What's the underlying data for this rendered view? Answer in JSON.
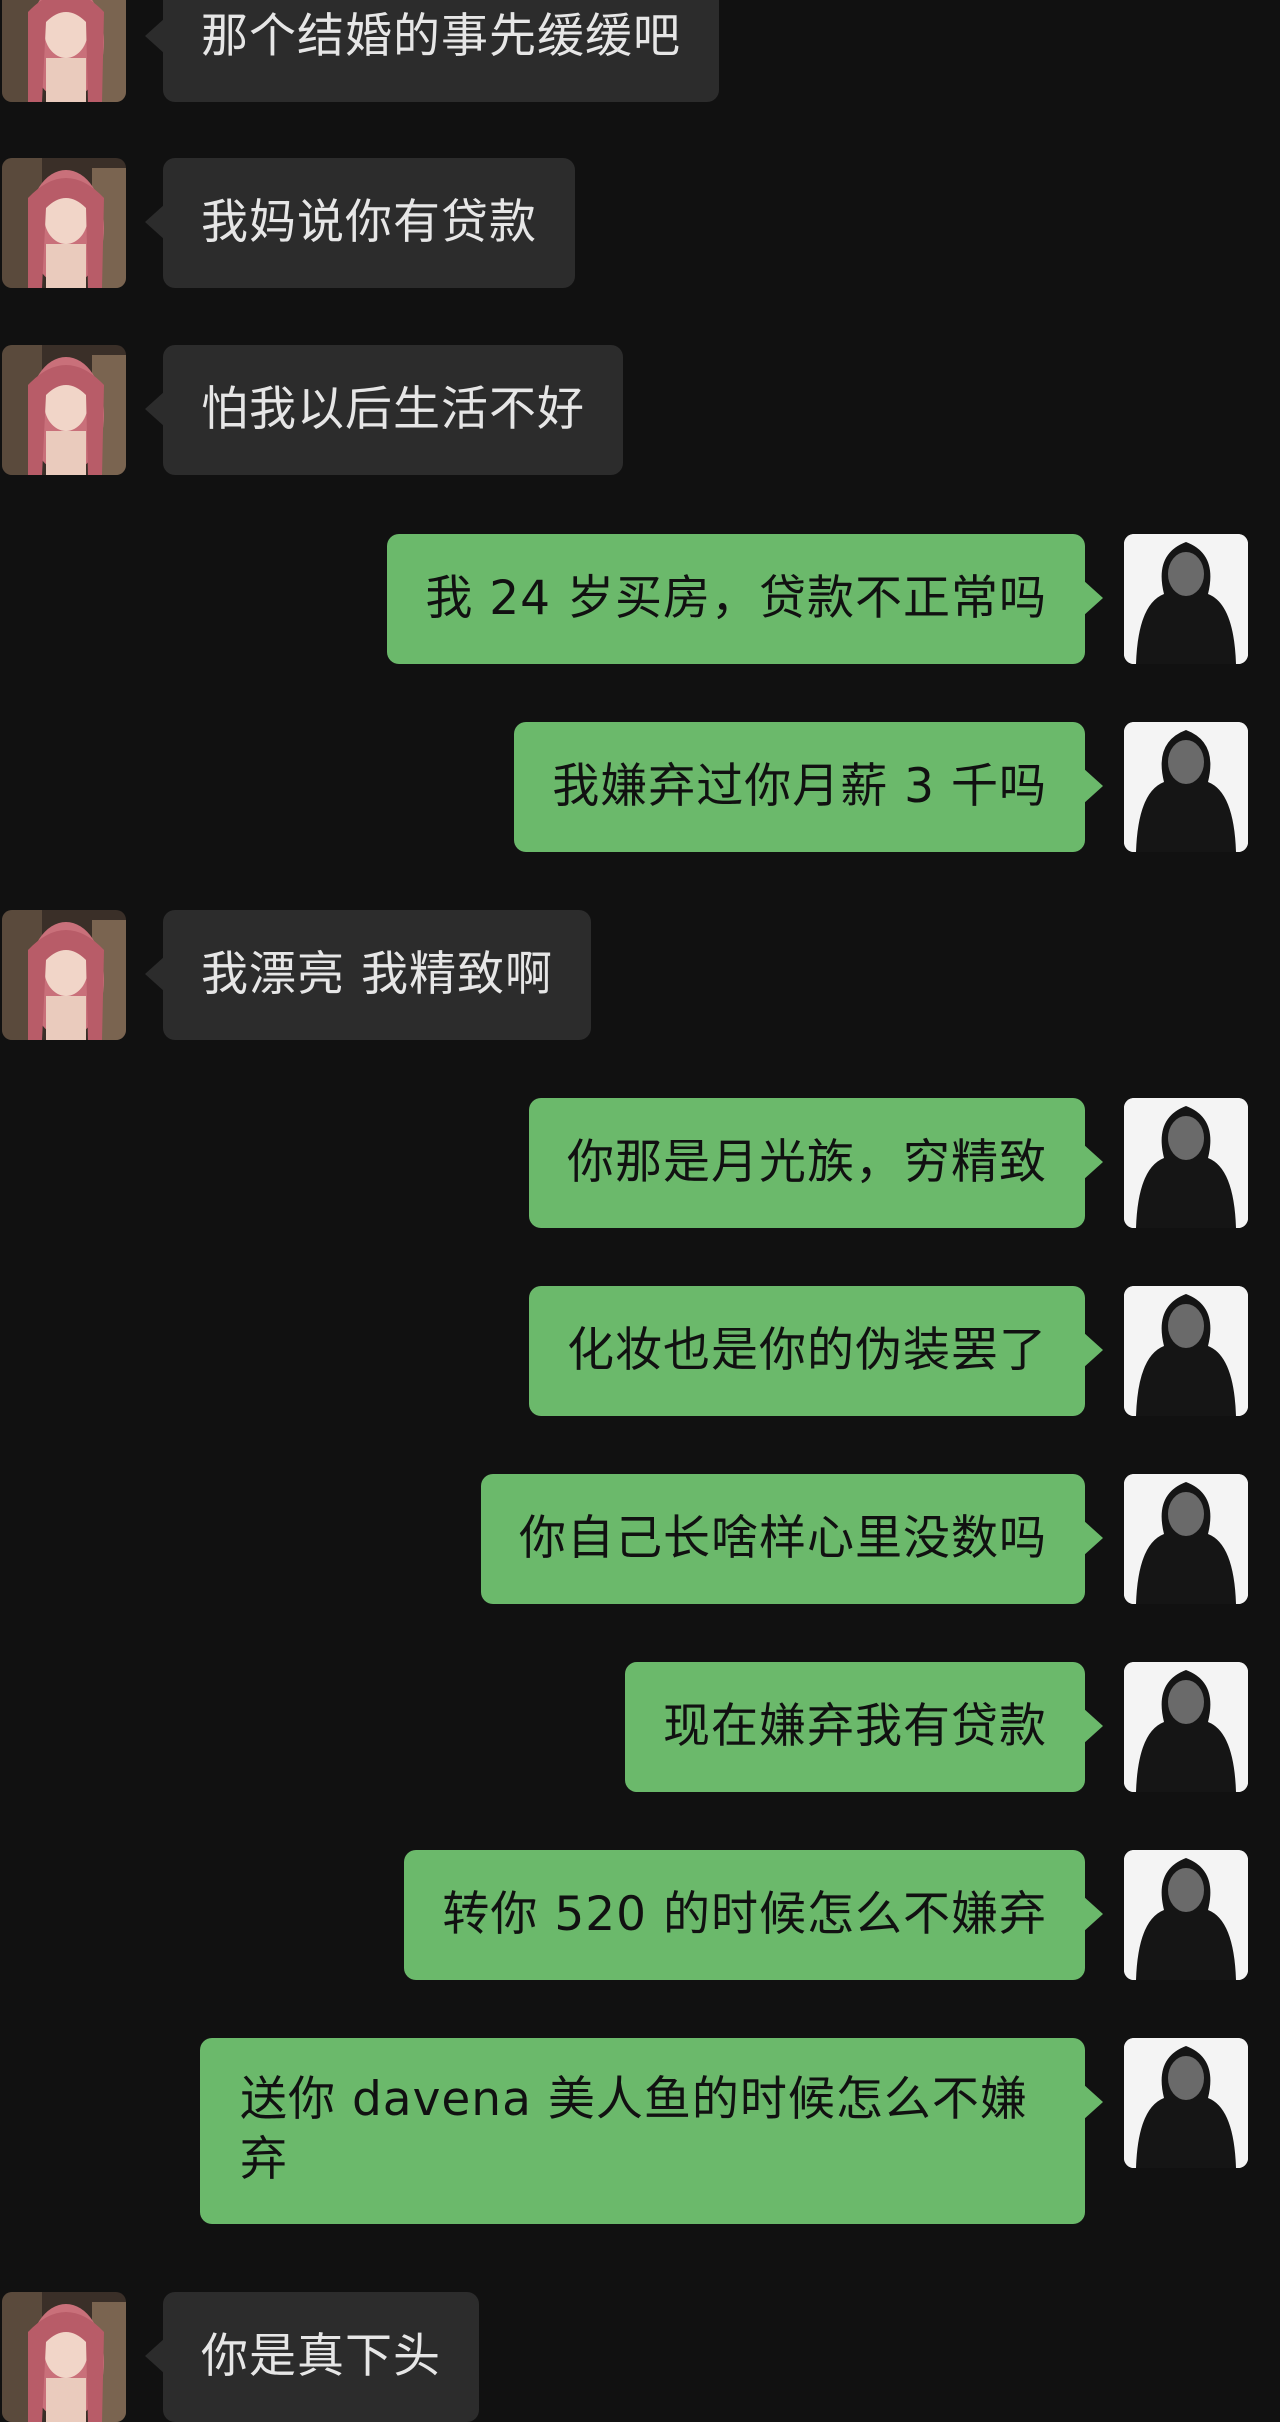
{
  "messages": [
    {
      "side": "in",
      "text": "那个结婚的事先缓缓吧"
    },
    {
      "side": "in",
      "text": "我妈说你有贷款"
    },
    {
      "side": "in",
      "text": "怕我以后生活不好"
    },
    {
      "side": "out",
      "text": "我 24 岁买房，贷款不正常吗"
    },
    {
      "side": "out",
      "text": "我嫌弃过你月薪 3 千吗"
    },
    {
      "side": "in",
      "text": "我漂亮 我精致啊"
    },
    {
      "side": "out",
      "text": "你那是月光族，穷精致"
    },
    {
      "side": "out",
      "text": "化妆也是你的伪装罢了"
    },
    {
      "side": "out",
      "text": "你自己长啥样心里没数吗"
    },
    {
      "side": "out",
      "text": "现在嫌弃我有贷款"
    },
    {
      "side": "out",
      "text": "转你 520 的时候怎么不嫌弃"
    },
    {
      "side": "out",
      "text": "送你 davena 美人鱼的时候怎么不嫌弃"
    },
    {
      "side": "in",
      "text": "你是真下头"
    }
  ],
  "colors": {
    "background": "#111111",
    "incoming_bubble": "#2c2c2c",
    "outgoing_bubble": "#6bb96b"
  },
  "avatars": {
    "incoming": "woman-photo-avatar",
    "outgoing": "masked-hooded-figure-avatar"
  }
}
